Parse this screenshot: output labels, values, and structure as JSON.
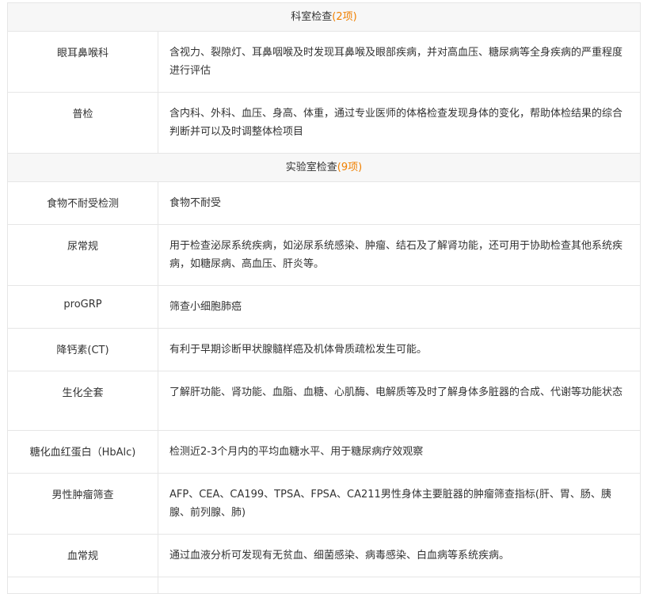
{
  "sections": [
    {
      "title": "科室检查",
      "count": "(2项)",
      "rows": [
        {
          "name": "眼耳鼻喉科",
          "desc": "含视力、裂隙灯、耳鼻咽喉及时发现耳鼻喉及眼部疾病，并对高血压、糖尿病等全身疾病的严重程度进行评估"
        },
        {
          "name": "普检",
          "desc": "含内科、外科、血压、身高、体重，通过专业医师的体格检查发现身体的变化，帮助体检结果的综合判断并可以及时调整体检项目"
        }
      ]
    },
    {
      "title": "实验室检查",
      "count": "(9项)",
      "rows": [
        {
          "name": "食物不耐受检测",
          "desc": "食物不耐受"
        },
        {
          "name": "尿常规",
          "desc": "用于检查泌尿系统疾病，如泌尿系统感染、肿瘤、结石及了解肾功能，还可用于协助检查其他系统疾病，如糖尿病、高血压、肝炎等。"
        },
        {
          "name": "proGRP",
          "desc": "筛查小细胞肺癌"
        },
        {
          "name": "降钙素(CT)",
          "desc": "有利于早期诊断甲状腺髓样癌及机体骨质疏松发生可能。"
        },
        {
          "name": "生化全套",
          "desc": "了解肝功能、肾功能、血脂、血糖、心肌酶、电解质等及时了解身体多脏器的合成、代谢等功能状态"
        },
        {
          "name": "糖化血红蛋白（HbAlc)",
          "desc": "检测近2-3个月内的平均血糖水平、用于糖尿病疗效观察"
        },
        {
          "name": "男性肿瘤筛查",
          "desc": "AFP、CEA、CA199、TPSA、FPSA、CA211男性身体主要脏器的肿瘤筛查指标(肝、胃、肠、胰腺、前列腺、肺)"
        },
        {
          "name": "血常规",
          "desc": "通过血液分析可发现有无贫血、细菌感染、病毒感染、白血病等系统疾病。"
        }
      ]
    }
  ]
}
